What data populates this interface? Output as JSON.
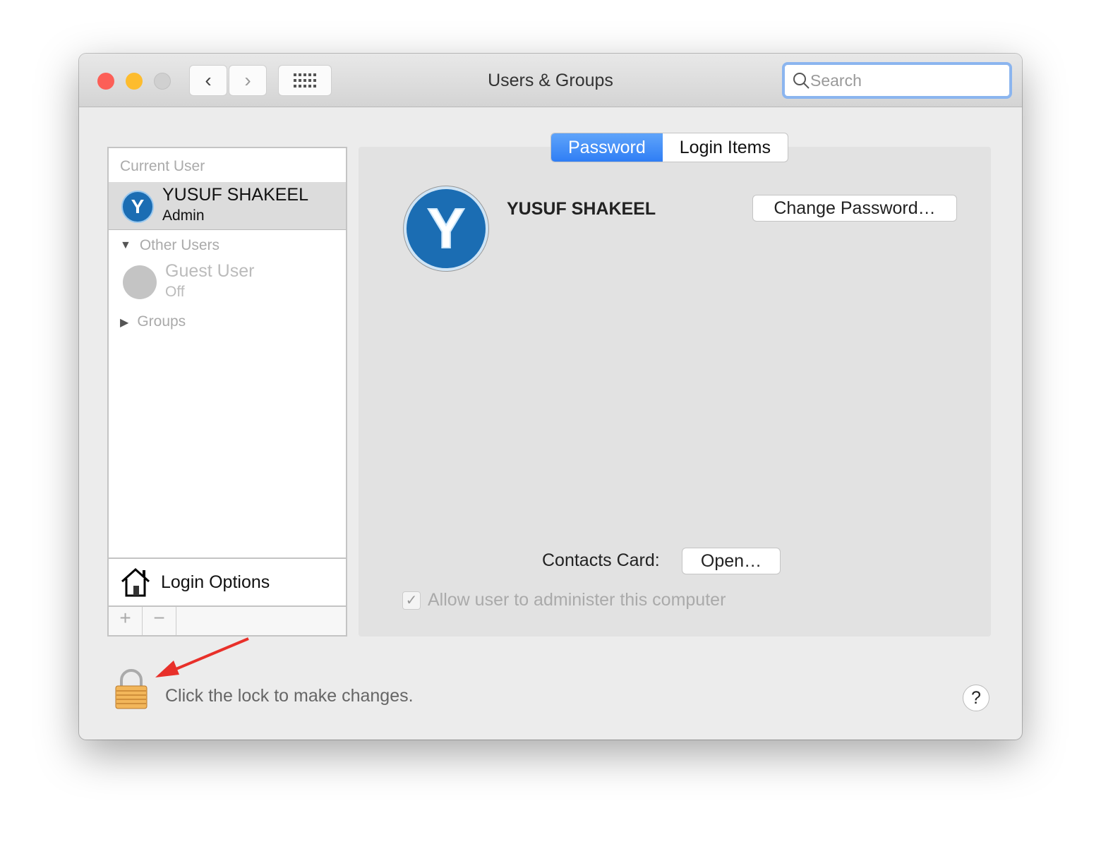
{
  "window": {
    "title": "Users & Groups",
    "search_placeholder": "Search"
  },
  "sidebar": {
    "current_user_header": "Current User",
    "current_user": {
      "name": "YUSUF SHAKEEL",
      "role": "Admin",
      "initial": "Y"
    },
    "other_users_header": "Other Users",
    "guest": {
      "name": "Guest User",
      "status": "Off"
    },
    "groups_label": "Groups",
    "login_options": "Login Options",
    "add": "+",
    "remove": "−"
  },
  "tabs": [
    {
      "label": "Password",
      "active": true
    },
    {
      "label": "Login Items",
      "active": false
    }
  ],
  "main": {
    "user_name": "YUSUF SHAKEEL",
    "initial": "Y",
    "change_password": "Change Password…",
    "contacts_label": "Contacts Card:",
    "open_button": "Open…",
    "admin_checkbox": {
      "label": "Allow user to administer this computer",
      "checked": true
    }
  },
  "footer": {
    "lock_text": "Click the lock to make changes.",
    "help": "?"
  },
  "colors": {
    "accent": "#3d8ef7",
    "annotation_arrow": "#e8302a"
  }
}
